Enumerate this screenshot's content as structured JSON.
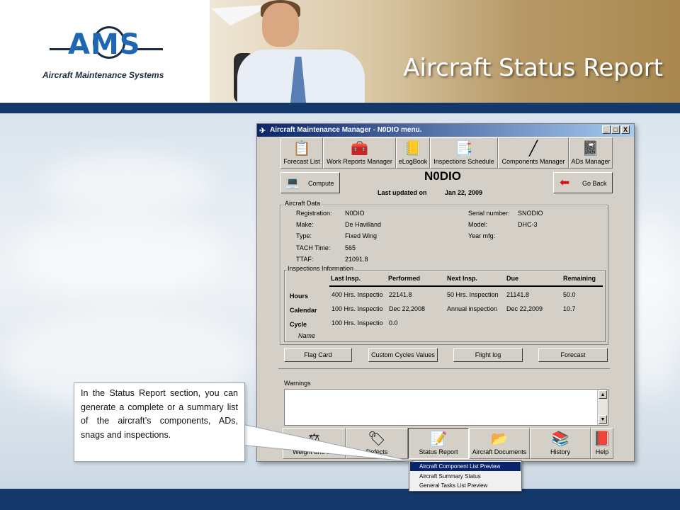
{
  "slide": {
    "title": "Aircraft Status Report",
    "logo_text": "AMS",
    "logo_subtitle": "Aircraft Maintenance Systems"
  },
  "window": {
    "title": "Aircraft Maintenance Manager - N0DIO menu.",
    "controls": [
      "_",
      "□",
      "X"
    ],
    "toolbar": [
      {
        "label": "Forecast List",
        "icon": "clipboard-icon"
      },
      {
        "label": "Work Reports Manager",
        "icon": "toolbox-icon"
      },
      {
        "label": "eLogBook",
        "icon": "logbook-icon"
      },
      {
        "label": "Inspections Schedule",
        "icon": "schedule-icon"
      },
      {
        "label": "Components Manager",
        "icon": "component-icon"
      },
      {
        "label": "ADs Manager",
        "icon": "notebook-icon"
      }
    ],
    "compute_label": "Compute",
    "goback_label": "Go Back",
    "registration_title": "N0DIO",
    "last_updated_label": "Last updated on",
    "last_updated_value": "Jan 22, 2009",
    "aircraft_data": {
      "group_label": "Aircraft Data",
      "left": [
        {
          "label": "Registration:",
          "value": "N0DIO"
        },
        {
          "label": "Make:",
          "value": "De Havilland"
        },
        {
          "label": "Type:",
          "value": "Fixed Wing"
        },
        {
          "label": "TACH Time:",
          "value": "565"
        },
        {
          "label": "TTAF:",
          "value": "21091.8"
        }
      ],
      "right": [
        {
          "label": "Serial number:",
          "value": "SNODIO"
        },
        {
          "label": "Model:",
          "value": "DHC-3"
        },
        {
          "label": "Year mfg:",
          "value": ""
        }
      ]
    },
    "inspections": {
      "group_label": "Inspections Information",
      "headers": [
        "Last Insp.",
        "Performed",
        "Next Insp.",
        "Due",
        "Remaining"
      ],
      "rows": [
        {
          "label": "Hours",
          "cells": [
            "400 Hrs. Inspectio",
            "22141.8",
            "50 Hrs. Inspection",
            "21141.8",
            "50.0"
          ]
        },
        {
          "label": "Calendar",
          "cells": [
            "100 Hrs. Inspectio",
            "Dec 22,2008",
            "Annual inspection",
            "Dec 22,2009",
            "10.7"
          ]
        },
        {
          "label": "Cycle",
          "cells": [
            "100 Hrs. Inspectio",
            "0.0",
            "",
            "",
            ""
          ]
        }
      ],
      "name_label": "Name"
    },
    "action_buttons": [
      "Flag Card",
      "Custom Cycles Values",
      "Flight log",
      "Forecast"
    ],
    "warnings_label": "Warnings",
    "bottom_toolbar": [
      {
        "label": "Weight and Bal",
        "icon": "scale-icon"
      },
      {
        "label": "Defects",
        "icon": "tag-icon"
      },
      {
        "label": "Status Report",
        "icon": "report-icon"
      },
      {
        "label": "Aircraft Documents",
        "icon": "folder-icon"
      },
      {
        "label": "History",
        "icon": "books-icon"
      },
      {
        "label": "Help",
        "icon": "help-book-icon"
      }
    ]
  },
  "dropdown": {
    "items": [
      "Aircraft Component List Preview",
      "Aircraft Summary Status",
      "General Tasks List Preview"
    ],
    "selected_index": 0
  },
  "callout": {
    "text": "In the Status Report section, you can generate a complete or a summary list of the aircraft’s components, ADs, snags and inspections."
  }
}
